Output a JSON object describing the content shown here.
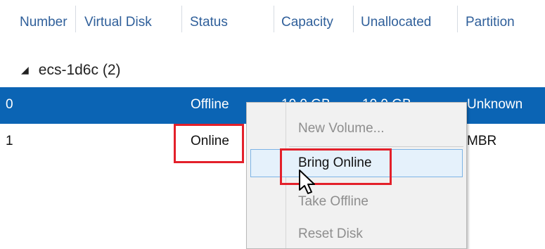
{
  "columns": [
    "Number",
    "Virtual Disk",
    "Status",
    "Capacity",
    "Unallocated",
    "Partition"
  ],
  "group": {
    "label": "ecs-1d6c (2)"
  },
  "rows": [
    {
      "number": "0",
      "status": "Offline",
      "capacity": "10.0 GB",
      "unallocated": "10.0 GB",
      "partition": "Unknown",
      "selected": true
    },
    {
      "number": "1",
      "status": "Online",
      "partition": "MBR",
      "selected": false
    }
  ],
  "context_menu": {
    "items": [
      {
        "label": "New Volume...",
        "enabled": false
      },
      {
        "label": "Bring Online",
        "enabled": true,
        "hovered": true
      },
      {
        "label": "Take Offline",
        "enabled": false
      },
      {
        "label": "Reset Disk",
        "enabled": false
      }
    ]
  },
  "colors": {
    "selection": "#0b64b4",
    "highlight_box": "#e3202a",
    "header_text": "#2f5f9a"
  },
  "icons": [
    "expand-triangle-icon",
    "mouse-pointer-icon"
  ]
}
